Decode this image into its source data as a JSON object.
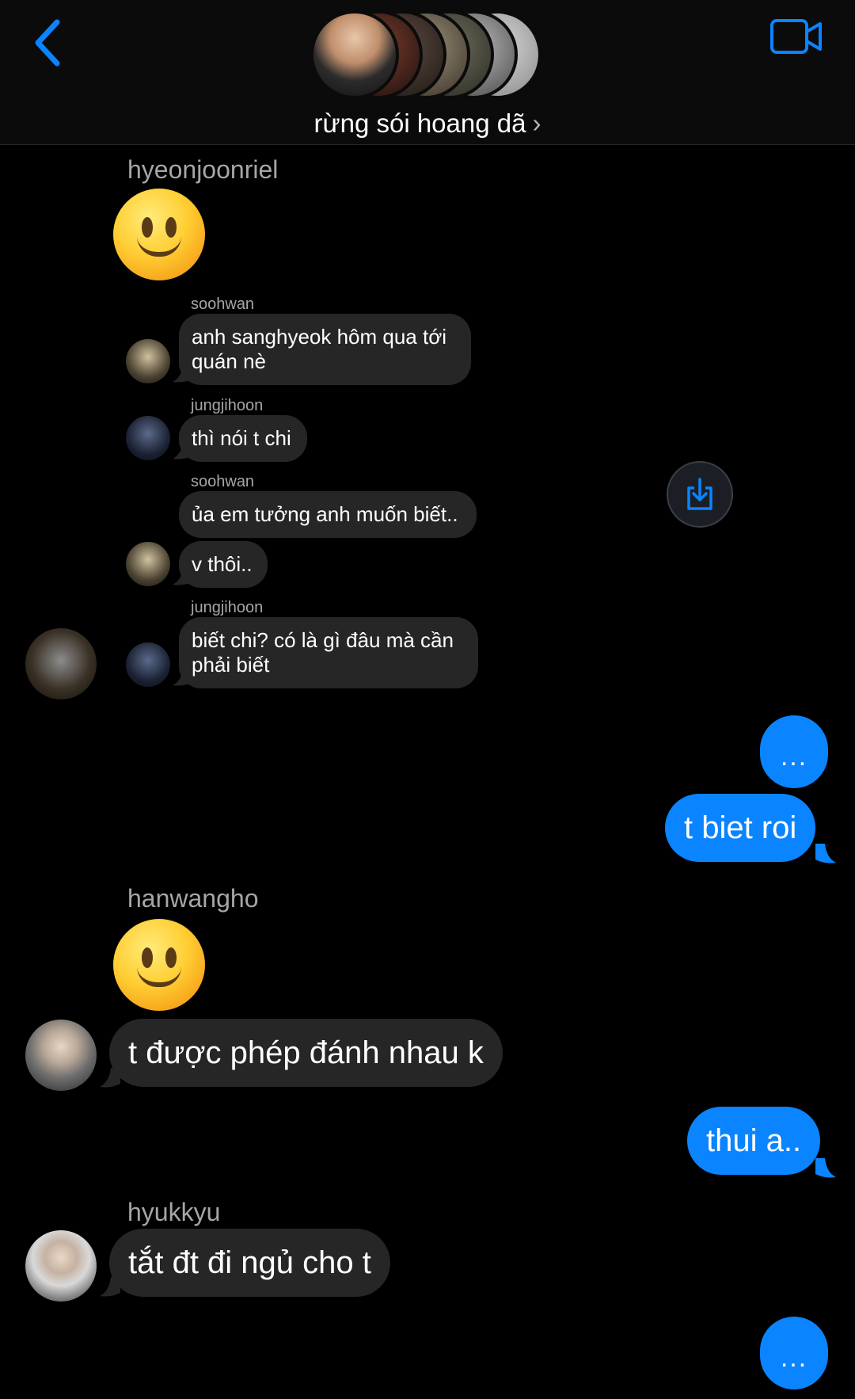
{
  "header": {
    "title": "rừng sói hoang dã",
    "back_icon": "chevron-left-icon",
    "video_icon": "video-camera-icon",
    "accent": "#0a84ff"
  },
  "messages": {
    "sender_1": "hyeonjoonriel",
    "reply_1_name": "soohwan",
    "reply_1_text": "anh sanghyeok hôm qua tới quán nè",
    "reply_2_name": "jungjihoon",
    "reply_2_text": "thì nói t chi",
    "reply_3_name": "soohwan",
    "reply_3_text_a": "ủa em tưởng anh muốn biết..",
    "reply_3_text_b": "v thôi..",
    "reply_4_name": "jungjihoon",
    "reply_4_text": "biết chi? có là gì đâu mà cần phải biết",
    "mine_1": "...",
    "mine_2": "t biet roi",
    "sender_2": "hanwangho",
    "msg_hanwangho": "t được phép đánh nhau k",
    "mine_3": "thui a..",
    "sender_3": "hyukkyu",
    "msg_hyukkyu": "tắt đt đi ngủ cho t",
    "mine_4": "..."
  },
  "colors": {
    "background": "#000000",
    "bubble_theirs": "#262626",
    "bubble_mine": "#0a84ff",
    "sender_text": "#a6a6a6"
  }
}
